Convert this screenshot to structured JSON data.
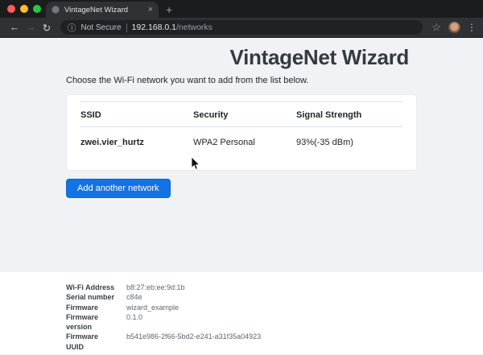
{
  "colors": {
    "accent_blue": "#1273e6",
    "page_background": "#f0f2f5",
    "chrome_tabstrip": "#1b1c1e",
    "chrome_toolbar": "#303134",
    "omnibox_background": "#202124",
    "traffic_red": "#ff5f57",
    "traffic_yellow": "#febc2e",
    "traffic_green": "#28c840"
  },
  "browser": {
    "tab": {
      "title": "VintageNet Wizard",
      "close_icon": "×",
      "new_tab_icon": "+"
    },
    "toolbar": {
      "back_icon": "←",
      "forward_icon": "→",
      "reload_icon": "↻",
      "info_icon": "ⓘ",
      "security_label": "Not Secure",
      "url_host": "192.168.0.1",
      "url_path": "/networks",
      "star_icon": "☆",
      "kebab_icon": "⋮"
    }
  },
  "page": {
    "title": "VintageNet Wizard",
    "subtitle": "Choose the Wi-Fi network you want to add from the list below.",
    "table": {
      "headers": [
        "SSID",
        "Security",
        "Signal Strength"
      ],
      "rows": [
        [
          "zwei.vier_hurtz",
          "WPA2 Personal",
          "93%(-35 dBm)"
        ]
      ]
    },
    "button_label": "Add another network",
    "footer": {
      "rows": [
        {
          "label": "Wi-Fi Address",
          "value": "b8:27:eb:ee:9d:1b"
        },
        {
          "label": "Serial number",
          "value": "c84e"
        },
        {
          "label": "Firmware",
          "value": "wizard_example"
        },
        {
          "label": "Firmware version",
          "value": "0.1.0"
        },
        {
          "label": "Firmware UUID",
          "value": "b541e986-2f66-5bd2-e241-a31f35a04923"
        }
      ]
    }
  }
}
